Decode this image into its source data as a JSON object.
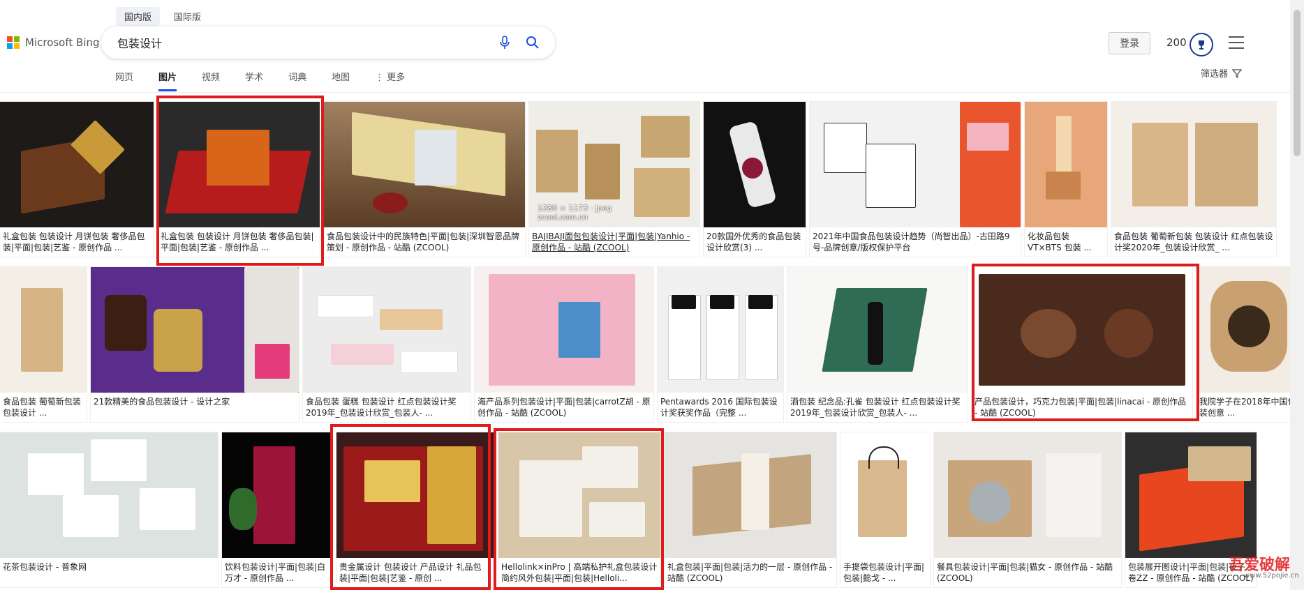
{
  "header": {
    "region_tabs": [
      "国内版",
      "国际版"
    ],
    "logo_text": "Microsoft Bing",
    "search_query": "包装设计",
    "login_label": "登录",
    "points": "200",
    "filter_label": "筛选器"
  },
  "nav": {
    "tabs": [
      "网页",
      "图片",
      "视频",
      "学术",
      "词典",
      "地图",
      "⋮ 更多"
    ],
    "active": "图片"
  },
  "results": {
    "row1": [
      {
        "caption": "礼盒包装 包装设计 月饼包装 奢侈品包装|平面|包装|艺鉴 - 原创作品 ..."
      },
      {
        "caption": "礼盒包装 包装设计 月饼包装 奢侈品包装|平面|包装|艺鉴 - 原创作品 ..."
      },
      {
        "caption": "食品包装设计中的民族特色|平面|包装|深圳智恩品牌策划 - 原创作品 - 站酷 (ZCOOL)"
      },
      {
        "caption": "BAJIBAJI面包包装设计|平面|包装|Yanhio - 原创作品 - 站酷 (ZCOOL)",
        "meta": "1280 × 1173 · jpeg",
        "source": "zcool.com.cn"
      },
      {
        "caption": "20款国外优秀的食品包装设计欣赏(3) ..."
      },
      {
        "caption": "2021年中国食品包装设计趋势（尚智出品）-古田路9号-品牌创意/版权保护平台"
      },
      {
        "caption": "化妆品包装 VT×BTS 包装 ..."
      },
      {
        "caption": "食品包装 葡萄新包装 包装设计 红点包装设计奖2020年_包装设计欣赏_ ..."
      }
    ],
    "row2": [
      {
        "caption": "食品包装 葡萄新包装 包装设计 ..."
      },
      {
        "caption": "21款精美的食品包装设计 - 设计之家"
      },
      {
        "caption": "食品包装 蛋糕 包装设计 红点包装设计奖2019年_包装设计欣赏_包装人- ..."
      },
      {
        "caption": "海产品系列包装设计|平面|包装|carrotZ胡 - 原创作品 - 站酷 (ZCOOL)"
      },
      {
        "caption": "Pentawards 2016 国际包装设计奖获奖作品（完整 ..."
      },
      {
        "caption": "酒包装 纪念品:孔雀 包装设计 红点包装设计奖2019年_包装设计欣赏_包装人- ..."
      },
      {
        "caption": "产品包装设计，巧克力包装|平面|包装|linacai - 原创作品 - 站酷 (ZCOOL)"
      },
      {
        "caption": "我院学子在2018年中国包装创意 ..."
      }
    ],
    "row3": [
      {
        "caption": "花茶包装设计 - 普象网"
      },
      {
        "caption": "饮料包装设计|平面|包装|白万才 - 原创作品 ..."
      },
      {
        "caption": "贵金属设计 包装设计 产品设计 礼品包装|平面|包装|艺鉴 - 原创 ..."
      },
      {
        "caption": "Hellolink×inPro | 高端私护礼盒包装设计 简约风外包装|平面|包装|Helloli..."
      },
      {
        "caption": "礼盒包装|平面|包装|活力的一层 - 原创作品 - 站酷 (ZCOOL)"
      },
      {
        "caption": "手提袋包装设计|平面|包装|懿戈 - ..."
      },
      {
        "caption": "餐具包装设计|平面|包装|猫女 - 原创作品 - 站酷 (ZCOOL)"
      },
      {
        "caption": "包装展开图设计|平面|包装|夜子卷ZZ - 原创作品 - 站酷 (ZCOOL)"
      }
    ]
  },
  "watermark": {
    "text": "吾爱破解",
    "sub": "www.52pojie.cn"
  },
  "colors": {
    "highlight": "#e01b1b",
    "bing_blue": "#174ae4"
  }
}
